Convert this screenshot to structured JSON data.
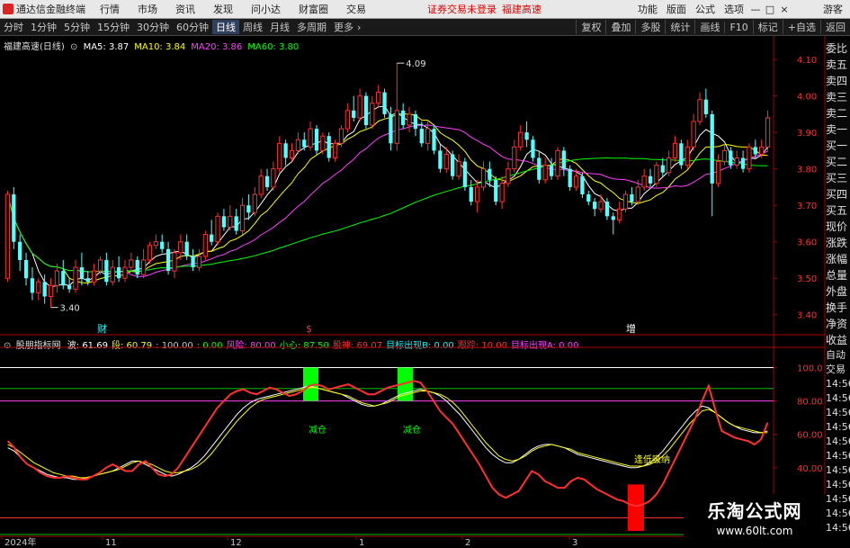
{
  "menubar": {
    "logo": "通达信金融终端",
    "items": [
      "行情",
      "市场",
      "资讯",
      "发现",
      "问小达",
      "财富圈",
      "交易"
    ],
    "notice": "证券交易未登录",
    "stock_name": "福建高速",
    "right_items": [
      "功能",
      "版面",
      "公式",
      "选项"
    ],
    "window_buttons": [
      "—",
      "□",
      "×"
    ],
    "guest": "游客"
  },
  "tabbar": {
    "tabs": [
      "分时",
      "1分钟",
      "5分钟",
      "15分钟",
      "30分钟",
      "60分钟",
      "日线",
      "周线",
      "月线",
      "多周期",
      "更多"
    ],
    "active_tab": "日线",
    "tools": [
      "复权",
      "叠加",
      "多股",
      "统计",
      "画线",
      "F10",
      "标记",
      "+自选",
      "返回"
    ]
  },
  "stock": {
    "name": "福建高速(日线)",
    "ma": [
      {
        "label": "MA5: 3.87",
        "color": "#ffffff"
      },
      {
        "label": "MA10: 3.84",
        "color": "#ffff00"
      },
      {
        "label": "MA20: 3.86",
        "color": "#ff40ff"
      },
      {
        "label": "MA60: 3.80",
        "color": "#00ff00"
      }
    ]
  },
  "indicator": {
    "name": "股朋指标网",
    "values": [
      {
        "label": "波: 61.69",
        "color": "#ffffff"
      },
      {
        "label": "段: 60.79",
        "color": "#ffff00"
      },
      {
        "label": ": 100.00",
        "color": "#c8c8c8"
      },
      {
        "label": ": 0.00",
        "color": "#00ff00"
      },
      {
        "label": "风险: 80.00",
        "color": "#ff40ff"
      },
      {
        "label": "小心: 87.50",
        "color": "#00ff00"
      },
      {
        "label": "股神: 69.07",
        "color": "#ff3030"
      },
      {
        "label": "目标出现B: 0.00",
        "color": "#00ffff"
      },
      {
        "label": "跟踪: 10.00",
        "color": "#ff3030"
      },
      {
        "label": "目标出现A: 0.00",
        "color": "#ff40ff"
      }
    ]
  },
  "side_labels_top": [
    "委比",
    "卖五",
    "卖四",
    "卖三",
    "卖二",
    "卖一",
    "买一",
    "买二",
    "买三",
    "买四",
    "买五",
    "现价",
    "涨跌",
    "涨幅",
    "总量",
    "外盘",
    "换手",
    "净资",
    "收益"
  ],
  "side_labels_bottom": [
    "自动",
    "交易",
    "14:56",
    "14:56",
    "14:56",
    "14:56",
    "14:56",
    "14:56",
    "14:56",
    "14:56",
    "14:56",
    "14:56",
    "14:56"
  ],
  "watermark": {
    "line1": "乐淘公式网",
    "line2": "www.60lt.com"
  },
  "chart_data": {
    "type": "candlestick",
    "y_axis": {
      "range": [
        3.35,
        4.12
      ],
      "ticks": [
        "4.10",
        "4.00",
        "3.90",
        "3.80",
        "3.70",
        "3.60",
        "3.50",
        "3.40"
      ]
    },
    "high_marker": "4.09",
    "low_marker": "3.40",
    "event_labels": [
      {
        "text": "财",
        "color": "#00ffff"
      },
      {
        "text": "$",
        "color": "#ff3030"
      },
      {
        "text": "增",
        "color": "#ffffff"
      }
    ],
    "x_labels": [
      "2024年",
      "11",
      "12",
      "1",
      "2",
      "3"
    ],
    "colors": {
      "up": "#ff3030",
      "down": "#54ffff",
      "ma5": "#ffffff",
      "ma10": "#ffff00",
      "ma20": "#ff40ff",
      "ma60": "#00ff00"
    },
    "candles": [
      [
        3.5,
        3.73,
        3.74,
        3.49
      ],
      [
        3.73,
        3.6,
        3.75,
        3.58
      ],
      [
        3.6,
        3.55,
        3.62,
        3.52
      ],
      [
        3.55,
        3.5,
        3.57,
        3.48
      ],
      [
        3.5,
        3.46,
        3.53,
        3.44
      ],
      [
        3.46,
        3.49,
        3.5,
        3.44
      ],
      [
        3.49,
        3.45,
        3.51,
        3.43
      ],
      [
        3.45,
        3.48,
        3.5,
        3.42
      ],
      [
        3.48,
        3.52,
        3.54,
        3.46
      ],
      [
        3.52,
        3.48,
        3.55,
        3.47
      ],
      [
        3.48,
        3.47,
        3.5,
        3.46
      ],
      [
        3.47,
        3.53,
        3.55,
        3.46
      ],
      [
        3.53,
        3.5,
        3.57,
        3.48
      ],
      [
        3.5,
        3.49,
        3.52,
        3.48
      ],
      [
        3.49,
        3.52,
        3.54,
        3.48
      ],
      [
        3.52,
        3.55,
        3.56,
        3.51
      ],
      [
        3.55,
        3.49,
        3.57,
        3.48
      ],
      [
        3.49,
        3.53,
        3.55,
        3.48
      ],
      [
        3.53,
        3.5,
        3.56,
        3.49
      ],
      [
        3.5,
        3.53,
        3.55,
        3.49
      ],
      [
        3.53,
        3.55,
        3.57,
        3.52
      ],
      [
        3.55,
        3.51,
        3.56,
        3.5
      ],
      [
        3.51,
        3.55,
        3.58,
        3.5
      ],
      [
        3.55,
        3.59,
        3.6,
        3.54
      ],
      [
        3.59,
        3.6,
        3.62,
        3.58
      ],
      [
        3.6,
        3.58,
        3.62,
        3.57
      ],
      [
        3.58,
        3.52,
        3.6,
        3.51
      ],
      [
        3.52,
        3.57,
        3.58,
        3.5
      ],
      [
        3.57,
        3.6,
        3.62,
        3.55
      ],
      [
        3.6,
        3.56,
        3.62,
        3.55
      ],
      [
        3.56,
        3.53,
        3.58,
        3.52
      ],
      [
        3.53,
        3.56,
        3.58,
        3.52
      ],
      [
        3.56,
        3.62,
        3.63,
        3.55
      ],
      [
        3.62,
        3.6,
        3.66,
        3.59
      ],
      [
        3.6,
        3.67,
        3.68,
        3.59
      ],
      [
        3.67,
        3.64,
        3.69,
        3.63
      ],
      [
        3.64,
        3.67,
        3.7,
        3.63
      ],
      [
        3.67,
        3.63,
        3.69,
        3.62
      ],
      [
        3.63,
        3.7,
        3.72,
        3.62
      ],
      [
        3.7,
        3.68,
        3.73,
        3.66
      ],
      [
        3.68,
        3.73,
        3.75,
        3.67
      ],
      [
        3.73,
        3.78,
        3.8,
        3.72
      ],
      [
        3.78,
        3.75,
        3.8,
        3.74
      ],
      [
        3.75,
        3.8,
        3.82,
        3.74
      ],
      [
        3.8,
        3.87,
        3.89,
        3.79
      ],
      [
        3.87,
        3.83,
        3.88,
        3.81
      ],
      [
        3.83,
        3.85,
        3.87,
        3.82
      ],
      [
        3.85,
        3.88,
        3.9,
        3.84
      ],
      [
        3.88,
        3.86,
        3.9,
        3.85
      ],
      [
        3.86,
        3.91,
        3.93,
        3.85
      ],
      [
        3.91,
        3.85,
        3.92,
        3.84
      ],
      [
        3.85,
        3.89,
        3.9,
        3.84
      ],
      [
        3.89,
        3.83,
        3.9,
        3.82
      ],
      [
        3.83,
        3.87,
        3.88,
        3.82
      ],
      [
        3.87,
        3.91,
        3.92,
        3.86
      ],
      [
        3.91,
        3.96,
        3.98,
        3.9
      ],
      [
        3.96,
        3.94,
        4.0,
        3.93
      ],
      [
        3.94,
        4.0,
        4.02,
        3.93
      ],
      [
        4.0,
        3.92,
        4.01,
        3.91
      ],
      [
        3.92,
        3.98,
        4.0,
        3.91
      ],
      [
        3.98,
        4.01,
        4.03,
        3.97
      ],
      [
        4.01,
        3.95,
        4.02,
        3.94
      ],
      [
        3.95,
        3.87,
        3.97,
        3.85
      ],
      [
        3.87,
        3.96,
        4.09,
        3.85
      ],
      [
        3.96,
        3.92,
        3.98,
        3.91
      ],
      [
        3.92,
        3.95,
        3.97,
        3.9
      ],
      [
        3.95,
        3.91,
        3.96,
        3.89
      ],
      [
        3.91,
        3.87,
        3.93,
        3.86
      ],
      [
        3.87,
        3.91,
        3.93,
        3.85
      ],
      [
        3.91,
        3.85,
        3.92,
        3.84
      ],
      [
        3.85,
        3.8,
        3.87,
        3.79
      ],
      [
        3.8,
        3.84,
        3.86,
        3.79
      ],
      [
        3.84,
        3.78,
        3.85,
        3.77
      ],
      [
        3.78,
        3.82,
        3.84,
        3.77
      ],
      [
        3.82,
        3.75,
        3.83,
        3.74
      ],
      [
        3.75,
        3.71,
        3.77,
        3.7
      ],
      [
        3.71,
        3.75,
        3.77,
        3.68
      ],
      [
        3.75,
        3.8,
        3.82,
        3.74
      ],
      [
        3.8,
        3.77,
        3.82,
        3.75
      ],
      [
        3.77,
        3.71,
        3.78,
        3.7
      ],
      [
        3.71,
        3.76,
        3.78,
        3.69
      ],
      [
        3.76,
        3.8,
        3.82,
        3.75
      ],
      [
        3.8,
        3.86,
        3.88,
        3.79
      ],
      [
        3.86,
        3.9,
        3.92,
        3.85
      ],
      [
        3.9,
        3.88,
        3.93,
        3.86
      ],
      [
        3.88,
        3.83,
        3.89,
        3.82
      ],
      [
        3.83,
        3.77,
        3.85,
        3.76
      ],
      [
        3.77,
        3.81,
        3.83,
        3.76
      ],
      [
        3.81,
        3.78,
        3.83,
        3.77
      ],
      [
        3.78,
        3.85,
        3.86,
        3.77
      ],
      [
        3.85,
        3.8,
        3.86,
        3.78
      ],
      [
        3.8,
        3.75,
        3.81,
        3.74
      ],
      [
        3.75,
        3.78,
        3.8,
        3.74
      ],
      [
        3.78,
        3.73,
        3.79,
        3.72
      ],
      [
        3.73,
        3.71,
        3.74,
        3.7
      ],
      [
        3.71,
        3.69,
        3.72,
        3.67
      ],
      [
        3.69,
        3.71,
        3.73,
        3.68
      ],
      [
        3.71,
        3.67,
        3.72,
        3.66
      ],
      [
        3.67,
        3.66,
        3.68,
        3.62
      ],
      [
        3.66,
        3.69,
        3.71,
        3.65
      ],
      [
        3.69,
        3.73,
        3.74,
        3.68
      ],
      [
        3.73,
        3.71,
        3.75,
        3.7
      ],
      [
        3.71,
        3.75,
        3.77,
        3.7
      ],
      [
        3.75,
        3.78,
        3.8,
        3.74
      ],
      [
        3.78,
        3.76,
        3.8,
        3.75
      ],
      [
        3.76,
        3.81,
        3.82,
        3.75
      ],
      [
        3.81,
        3.79,
        3.83,
        3.78
      ],
      [
        3.79,
        3.83,
        3.85,
        3.78
      ],
      [
        3.83,
        3.87,
        3.89,
        3.82
      ],
      [
        3.87,
        3.81,
        3.88,
        3.8
      ],
      [
        3.81,
        3.86,
        3.88,
        3.8
      ],
      [
        3.86,
        3.93,
        3.95,
        3.85
      ],
      [
        3.93,
        3.99,
        4.01,
        3.92
      ],
      [
        3.99,
        3.95,
        4.02,
        3.94
      ],
      [
        3.95,
        3.76,
        3.96,
        3.67
      ],
      [
        3.76,
        3.82,
        3.84,
        3.75
      ],
      [
        3.82,
        3.85,
        3.87,
        3.81
      ],
      [
        3.85,
        3.81,
        3.86,
        3.8
      ],
      [
        3.81,
        3.83,
        3.85,
        3.8
      ],
      [
        3.83,
        3.8,
        3.85,
        3.79
      ],
      [
        3.8,
        3.86,
        3.87,
        3.79
      ],
      [
        3.86,
        3.84,
        3.88,
        3.83
      ],
      [
        3.84,
        3.86,
        3.88,
        3.83
      ],
      [
        3.86,
        3.94,
        3.96,
        3.85
      ]
    ],
    "indicator_axis": {
      "range": [
        0,
        110
      ],
      "ticks": [
        "100.0",
        "80.00",
        "60.00",
        "40.00"
      ]
    },
    "indicator_lines": [
      {
        "name": "波",
        "color": "#ffffff",
        "values": [
          52,
          50,
          46,
          42,
          40,
          38,
          36,
          35,
          34,
          34,
          33,
          33,
          34,
          35,
          36,
          37,
          38,
          40,
          42,
          44,
          44,
          42,
          40,
          38,
          36,
          35,
          36,
          38,
          40,
          43,
          47,
          52,
          57,
          62,
          67,
          72,
          76,
          79,
          81,
          82,
          83,
          84,
          85,
          86,
          87,
          88,
          89,
          88,
          87,
          86,
          85,
          84,
          82,
          80,
          78,
          77,
          77,
          78,
          80,
          82,
          84,
          85,
          86,
          87,
          86,
          85,
          83,
          80,
          76,
          72,
          67,
          62,
          57,
          52,
          48,
          45,
          43,
          43,
          45,
          48,
          51,
          53,
          54,
          54,
          53,
          52,
          50,
          48,
          47,
          46,
          45,
          44,
          43,
          42,
          41,
          40,
          40,
          41,
          43,
          46,
          50,
          55,
          60,
          65,
          70,
          74,
          77,
          76,
          73,
          70,
          67,
          65,
          63,
          62,
          61,
          61,
          62
        ]
      },
      {
        "name": "段",
        "color": "#ffff00",
        "values": [
          54,
          52,
          49,
          46,
          43,
          41,
          39,
          37,
          36,
          35,
          35,
          34,
          34,
          35,
          36,
          37,
          38,
          39,
          41,
          43,
          44,
          43,
          42,
          40,
          38,
          37,
          37,
          38,
          39,
          41,
          44,
          48,
          53,
          58,
          63,
          68,
          72,
          76,
          79,
          81,
          82,
          83,
          84,
          85,
          86,
          87,
          88,
          88,
          87,
          86,
          85,
          84,
          83,
          81,
          79,
          78,
          77,
          78,
          79,
          81,
          83,
          84,
          85,
          86,
          86,
          85,
          84,
          82,
          79,
          75,
          70,
          65,
          60,
          55,
          51,
          47,
          45,
          44,
          45,
          47,
          50,
          52,
          53,
          54,
          53,
          52,
          51,
          49,
          48,
          47,
          46,
          45,
          44,
          43,
          42,
          41,
          41,
          41,
          42,
          44,
          47,
          51,
          56,
          61,
          66,
          70,
          74,
          75,
          73,
          70,
          67,
          65,
          64,
          63,
          62,
          61,
          61
        ]
      },
      {
        "name": "股神",
        "color": "#ff3030",
        "values": [
          56,
          52,
          46,
          42,
          40,
          37,
          35,
          34,
          34,
          35,
          34,
          33,
          33,
          35,
          37,
          40,
          42,
          40,
          38,
          38,
          42,
          44,
          40,
          36,
          35,
          36,
          40,
          46,
          52,
          58,
          64,
          70,
          76,
          80,
          84,
          86,
          87,
          85,
          84,
          86,
          88,
          87,
          85,
          83,
          84,
          86,
          89,
          90,
          89,
          87,
          88,
          89,
          90,
          88,
          86,
          84,
          84,
          86,
          88,
          89,
          90,
          91,
          92,
          91,
          86,
          80,
          74,
          70,
          66,
          60,
          54,
          48,
          42,
          35,
          28,
          24,
          22,
          24,
          26,
          32,
          38,
          36,
          32,
          30,
          28,
          28,
          32,
          34,
          33,
          30,
          27,
          25,
          23,
          21,
          20,
          18,
          17,
          18,
          20,
          24,
          30,
          38,
          46,
          54,
          62,
          70,
          80,
          89,
          75,
          62,
          60,
          58,
          57,
          56,
          54,
          57,
          67
        ]
      }
    ],
    "indicator_levels": [
      {
        "value": 100,
        "color": "#ffffff"
      },
      {
        "value": 87.5,
        "color": "#00c000"
      },
      {
        "value": 80,
        "color": "#ff40ff"
      },
      {
        "value": 10,
        "color": "#ff3030"
      },
      {
        "value": 0,
        "color": "#00c000"
      }
    ],
    "indicator_annotations": [
      {
        "text": "减仓",
        "color": "#00ff00"
      },
      {
        "text": "减仓",
        "color": "#00ff00"
      },
      {
        "text": "逢低吸纳",
        "color": "#ffff00"
      }
    ]
  }
}
